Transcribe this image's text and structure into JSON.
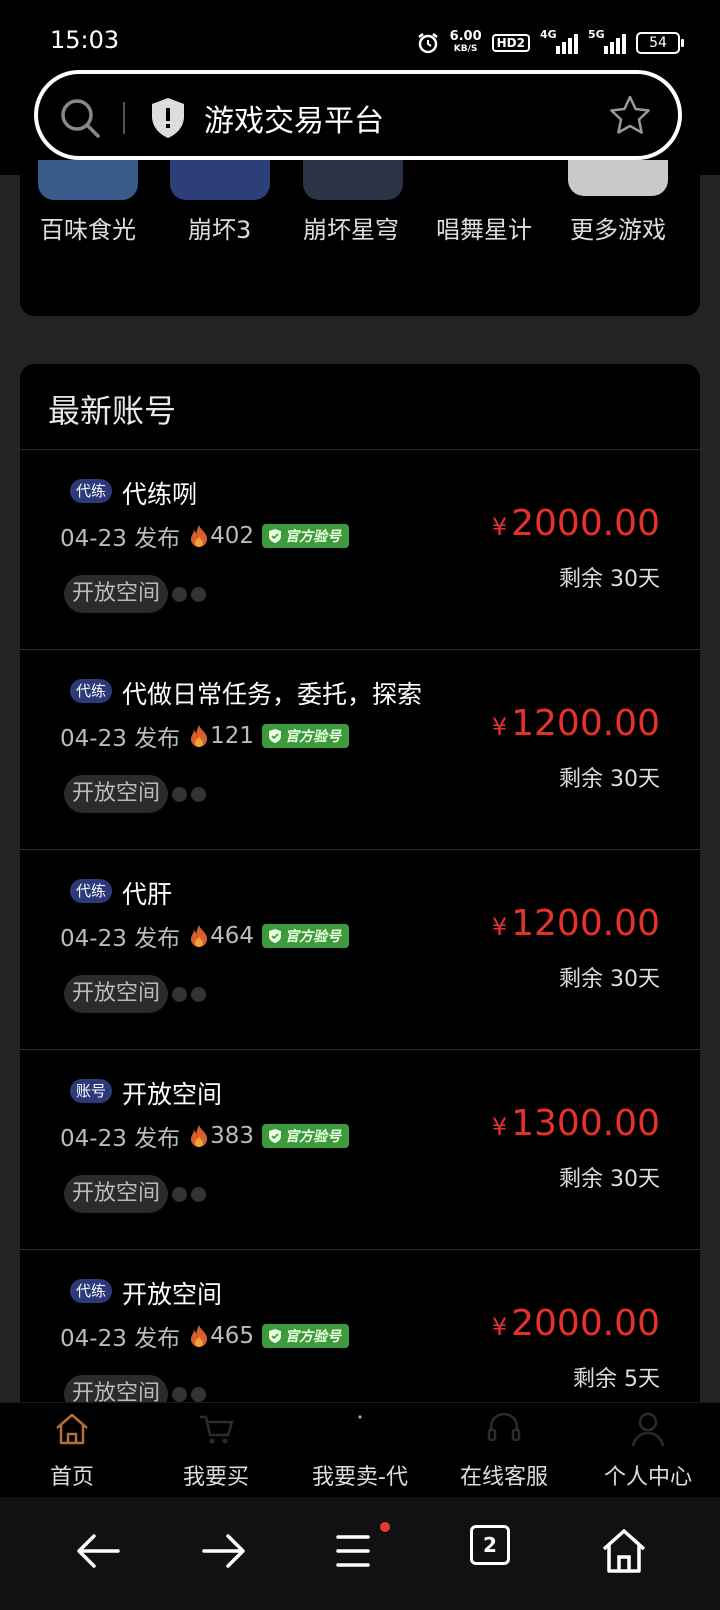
{
  "status_bar": {
    "time": "15:03",
    "net_speed": "6.00",
    "net_unit": "KB/S",
    "hd": "HD2",
    "signal1": "4G",
    "signal2": "5G",
    "battery": "54"
  },
  "address_bar": {
    "title": "游戏交易平台"
  },
  "games": [
    {
      "label": "百味食光",
      "color": "#3a5a8a"
    },
    {
      "label": "崩坏3",
      "color": "#2d3f78"
    },
    {
      "label": "崩坏星穹",
      "color": "#2a3445"
    },
    {
      "label": "唱舞星计",
      "color": "#000000"
    },
    {
      "label": "更多游戏",
      "color": "#c9c9c9"
    }
  ],
  "listings": {
    "heading": "最新账号",
    "items": [
      {
        "tag": "代练",
        "title": "代练咧",
        "date": "04-23 发布",
        "views": "402",
        "badge": "官方验号",
        "chip": "开放空间",
        "price": "2000.00",
        "currency": "¥",
        "remain": "剩余 30天"
      },
      {
        "tag": "代练",
        "title": "代做日常任务，委托，探索",
        "date": "04-23 发布",
        "views": "121",
        "badge": "官方验号",
        "chip": "开放空间",
        "price": "1200.00",
        "currency": "¥",
        "remain": "剩余 30天"
      },
      {
        "tag": "代练",
        "title": "代肝",
        "date": "04-23 发布",
        "views": "464",
        "badge": "官方验号",
        "chip": "开放空间",
        "price": "1200.00",
        "currency": "¥",
        "remain": "剩余 30天"
      },
      {
        "tag": "账号",
        "title": "开放空间",
        "date": "04-23 发布",
        "views": "383",
        "badge": "官方验号",
        "chip": "开放空间",
        "price": "1300.00",
        "currency": "¥",
        "remain": "剩余 30天"
      },
      {
        "tag": "代练",
        "title": "开放空间",
        "date": "04-23 发布",
        "views": "465",
        "badge": "官方验号",
        "chip": "开放空间",
        "price": "2000.00",
        "currency": "¥",
        "remain": "剩余 5天"
      }
    ]
  },
  "tabbar": {
    "items": [
      {
        "label": "首页",
        "icon": "home-icon",
        "active": true
      },
      {
        "label": "我要买",
        "icon": "cart-icon"
      },
      {
        "label": "我要卖-代",
        "icon": "sell-icon"
      },
      {
        "label": "在线客服",
        "icon": "headset-icon"
      },
      {
        "label": "个人中心",
        "icon": "person-icon"
      }
    ]
  },
  "system_nav": {
    "tabs_count": "2"
  },
  "colors": {
    "price_red": "#e6322d",
    "tag_blue": "#2c3a7a",
    "badge_green": "#3d9a3c",
    "active_tab": "#b0703a"
  }
}
